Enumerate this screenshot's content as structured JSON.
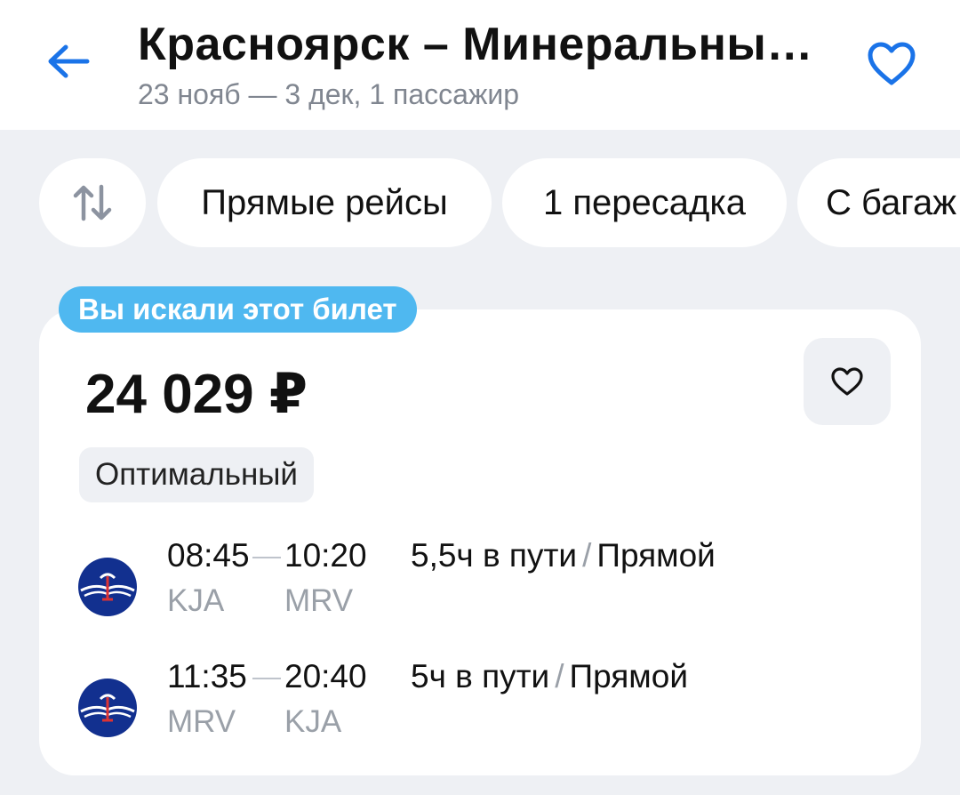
{
  "header": {
    "title": "Красноярск – Минеральны…",
    "subtitle": "23 нояб — 3 дек, 1 пассажир",
    "back_icon": "arrow-left-icon",
    "favorite_icon": "heart-outline-icon",
    "accent_color": "#1a73e8"
  },
  "filters": {
    "sort_icon": "sort-arrows-icon",
    "items": [
      {
        "label": "Прямые рейсы"
      },
      {
        "label": "1 пересадка"
      },
      {
        "label": "С багаж"
      }
    ]
  },
  "ticket": {
    "badge": "Вы искали этот билет",
    "badge_color": "#4fb8f0",
    "price": "24 029 ₽",
    "tag": "Оптимальный",
    "segments": [
      {
        "dep_time": "08:45",
        "arr_time": "10:20",
        "dep_code": "KJA",
        "arr_code": "MRV",
        "duration": "5,5ч в пути",
        "separator": "/",
        "type": "Прямой",
        "airline_icon": "aeroflot-logo-icon"
      },
      {
        "dep_time": "11:35",
        "arr_time": "20:40",
        "dep_code": "MRV",
        "arr_code": "KJA",
        "duration": "5ч в пути",
        "separator": "/",
        "type": "Прямой",
        "airline_icon": "aeroflot-logo-icon"
      }
    ]
  }
}
